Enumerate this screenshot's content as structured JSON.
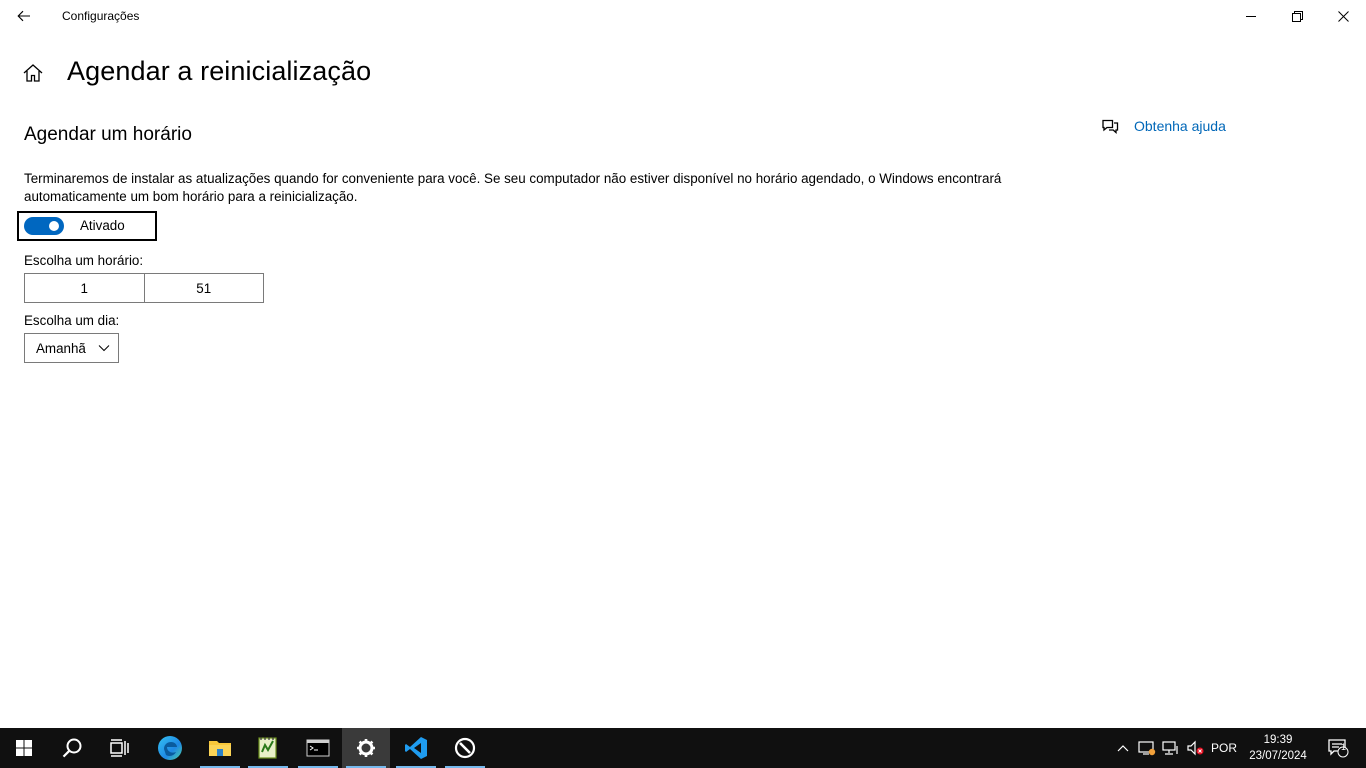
{
  "window": {
    "title": "Configurações",
    "back_icon": "back-arrow-icon",
    "controls": [
      "minimize-icon",
      "restore-icon",
      "close-icon"
    ]
  },
  "page": {
    "title": "Agendar a reinicialização",
    "home_icon": "home-icon",
    "section_title": "Agendar um horário",
    "description": "Terminaremos de instalar as atualizações quando for conveniente para você. Se seu computador não estiver disponível no horário agendado, o Windows encontrará automaticamente um bom horário para a reinicialização.",
    "toggle": {
      "label": "Ativado",
      "on": true,
      "accent": "#0067c0"
    },
    "time": {
      "label": "Escolha um horário:",
      "hour": "1",
      "minute": "51"
    },
    "day": {
      "label": "Escolha um dia:",
      "selected": "Amanhã"
    }
  },
  "help": {
    "label": "Obtenha ajuda",
    "icon": "chat-help-icon",
    "color": "#0067b8"
  },
  "taskbar": {
    "apps": [
      {
        "name": "start-icon"
      },
      {
        "name": "search-icon"
      },
      {
        "name": "task-view-icon"
      },
      {
        "name": "edge-icon"
      },
      {
        "name": "file-explorer-icon",
        "running": true
      },
      {
        "name": "notepad-plus-icon",
        "running": true
      },
      {
        "name": "terminal-icon",
        "running": true
      },
      {
        "name": "settings-icon",
        "running": true,
        "active": true
      },
      {
        "name": "vscode-icon",
        "running": true
      },
      {
        "name": "app-icon",
        "running": true
      }
    ],
    "tray": {
      "language": "POR",
      "time": "19:39",
      "date": "23/07/2024",
      "notifications": "1"
    }
  }
}
